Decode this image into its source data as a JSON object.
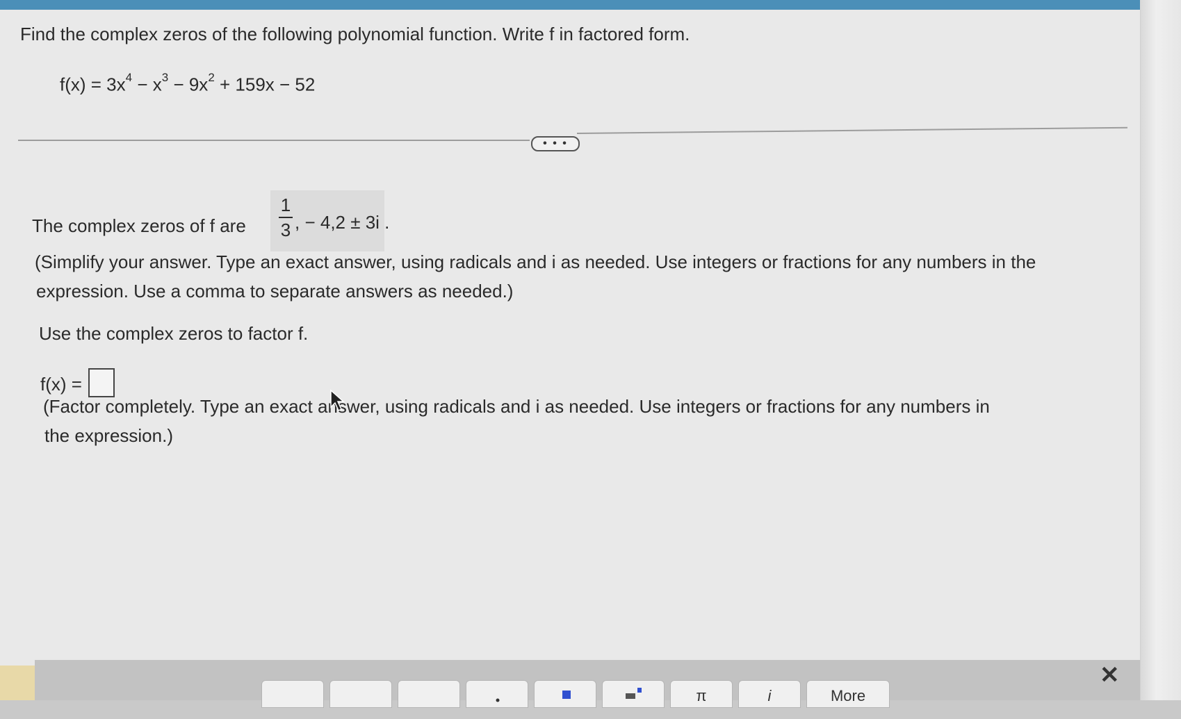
{
  "question": {
    "prompt": "Find the complex zeros of the following polynomial function. Write f in factored form.",
    "function_parts": {
      "lhs": "f(x) = 3x",
      "exp4": "4",
      "t2": " − x",
      "exp3": "3",
      "t3": " − 9x",
      "exp2": "2",
      "t4": " + 159x − 52"
    },
    "more_button": "• • •"
  },
  "zeros": {
    "label": "The complex zeros of f are",
    "fraction_num": "1",
    "fraction_den": "3",
    "rest": ", − 4,2 ± 3i .",
    "note_line1": "(Simplify your answer. Type an exact answer, using radicals and i as needed. Use integers or fractions for any numbers in the",
    "note_line2": "expression. Use a comma to separate answers as needed.)"
  },
  "factor": {
    "prompt": "Use the complex zeros to factor f.",
    "fx_label": "f(x) =",
    "note_line1": "(Factor completely. Type an exact answer, using radicals and i as needed. Use integers or fractions for any numbers in",
    "note_line2": "the expression.)"
  },
  "toolbar": {
    "pi": "π",
    "i": "i",
    "more": "More",
    "close": "✕"
  }
}
